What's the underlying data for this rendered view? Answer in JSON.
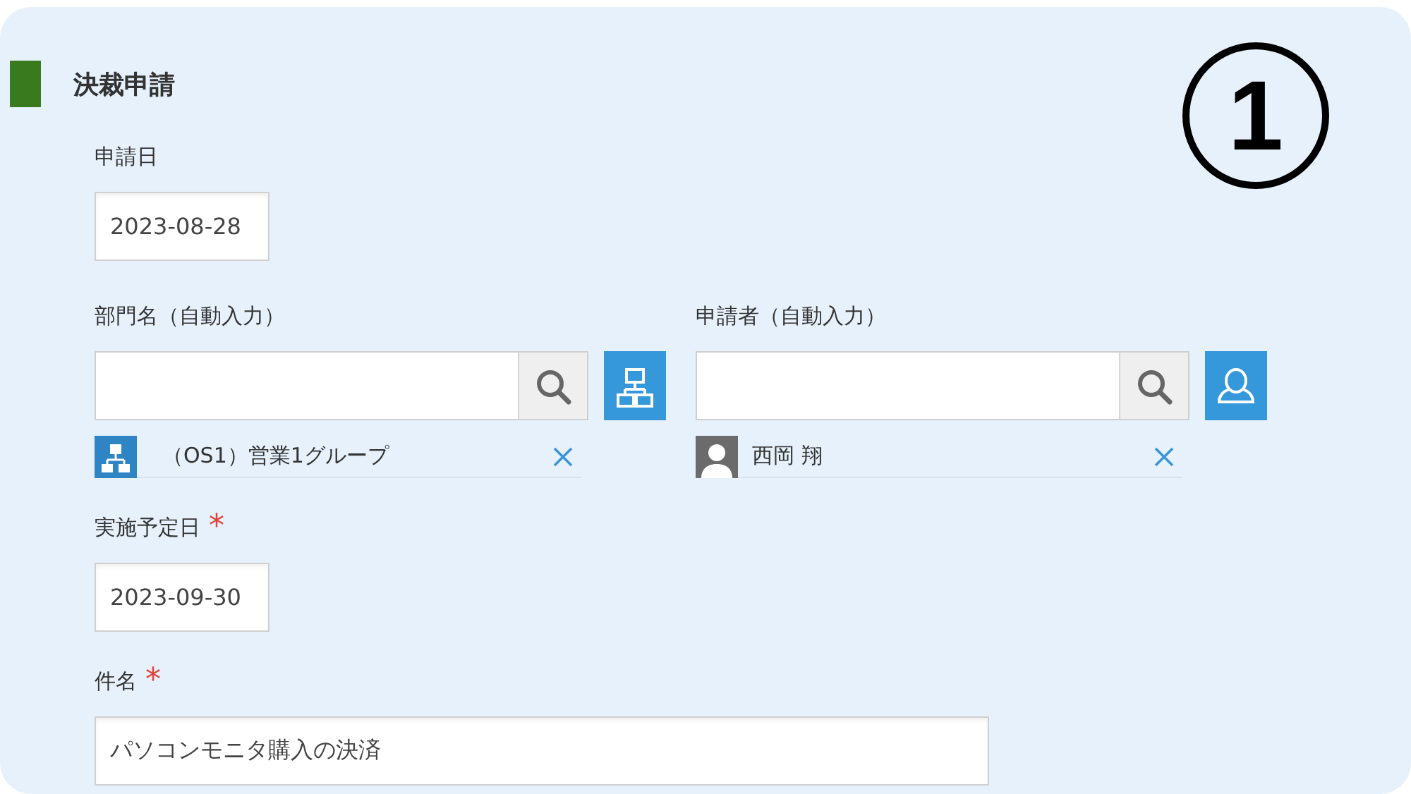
{
  "section": {
    "title": "決裁申請"
  },
  "step_badge": "1",
  "application_date": {
    "label": "申請日",
    "value": "2023-08-28"
  },
  "pickers": [
    {
      "kind": "department",
      "label": "部門名（自動入力）",
      "selection": "（OS1）営業1グループ"
    },
    {
      "kind": "user",
      "label": "申請者（自動入力）",
      "selection": "西岡 翔"
    }
  ],
  "planned_date": {
    "label": "実施予定日",
    "value": "2023-09-30",
    "required": true,
    "required_mark": "*"
  },
  "subject": {
    "label": "件名",
    "value": "パソコンモニタ購入の決済",
    "required": true,
    "required_mark": "*"
  }
}
